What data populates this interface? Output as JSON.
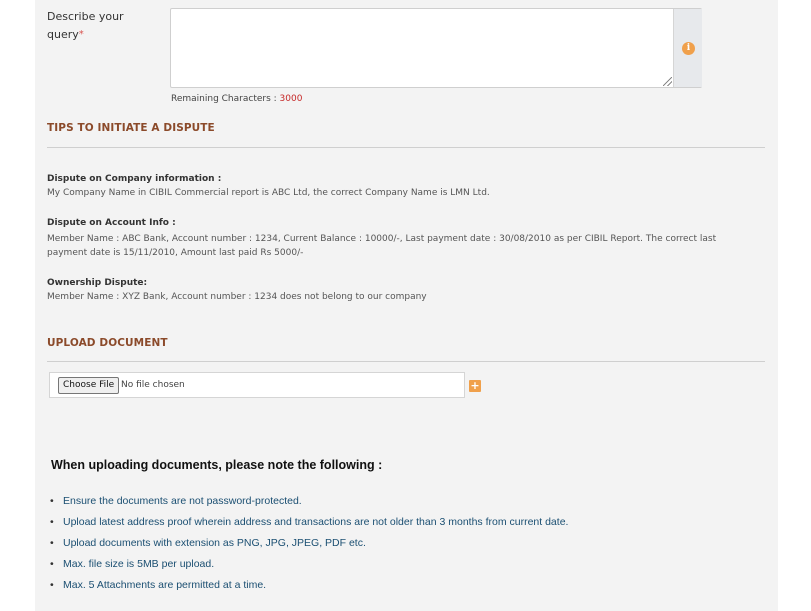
{
  "query": {
    "label": "Describe your query",
    "required_mark": "*",
    "value": "",
    "remaining_label": "Remaining Characters : ",
    "remaining_count": "3000"
  },
  "tips": {
    "title": "TIPS TO INITIATE A DISPUTE",
    "items": [
      {
        "heading": "Dispute on Company information :",
        "text": "My Company Name in CIBIL Commercial report is ABC Ltd, the correct Company Name is LMN Ltd."
      },
      {
        "heading": "Dispute on Account Info :",
        "text": "Member Name : ABC Bank, Account number : 1234, Current Balance : 10000/-, Last payment date : 30/08/2010 as per CIBIL Report. The correct last payment date is 15/11/2010, Amount last paid Rs 5000/-"
      },
      {
        "heading": "Ownership Dispute:",
        "text": "Member Name : XYZ Bank, Account number : 1234 does not belong to our company"
      }
    ]
  },
  "upload": {
    "title": "UPLOAD DOCUMENT",
    "choose_label": "Choose File",
    "status": "No file chosen",
    "add_icon": "plus-icon"
  },
  "notes": {
    "title": "When uploading documents, please note the following :",
    "items": [
      "Ensure the documents are not password-protected.",
      "Upload latest address proof wherein address and transactions are not older than 3 months from current date.",
      "Upload documents with extension as PNG, JPG, JPEG, PDF etc.",
      "Max. file size is 5MB per upload.",
      "Max. 5 Attachments are permitted at a time."
    ]
  },
  "colors": {
    "accent": "#f0a04b",
    "section_title": "#8b4a2a",
    "note_text": "#1b4f72",
    "remaining_count": "#c62828"
  }
}
